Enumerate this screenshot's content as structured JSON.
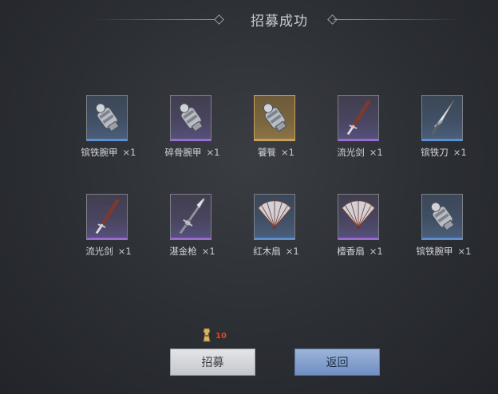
{
  "title": "招募成功",
  "items": [
    {
      "name": "镔铁腕甲",
      "qty": "×1",
      "rarity": "blue",
      "icon": "gauntlet-icon"
    },
    {
      "name": "碎骨腕甲",
      "qty": "×1",
      "rarity": "purple",
      "icon": "gauntlet-icon"
    },
    {
      "name": "饕餮",
      "qty": "×1",
      "rarity": "gold",
      "icon": "gauntlet-icon"
    },
    {
      "name": "流光剑",
      "qty": "×1",
      "rarity": "purple",
      "icon": "sword-icon"
    },
    {
      "name": "镔铁刀",
      "qty": "×1",
      "rarity": "blue",
      "icon": "blade-icon"
    },
    {
      "name": "流光剑",
      "qty": "×1",
      "rarity": "purple",
      "icon": "sword-icon"
    },
    {
      "name": "湛金枪",
      "qty": "×1",
      "rarity": "purple",
      "icon": "spear-icon"
    },
    {
      "name": "红木扇",
      "qty": "×1",
      "rarity": "blue",
      "icon": "fan-icon"
    },
    {
      "name": "檀香扇",
      "qty": "×1",
      "rarity": "purple",
      "icon": "fan-icon"
    },
    {
      "name": "镔铁腕甲",
      "qty": "×1",
      "rarity": "blue",
      "icon": "gauntlet-icon"
    }
  ],
  "cost": {
    "amount": "10",
    "icon": "token-icon"
  },
  "buttons": {
    "recruit": "招募",
    "back": "返回"
  }
}
